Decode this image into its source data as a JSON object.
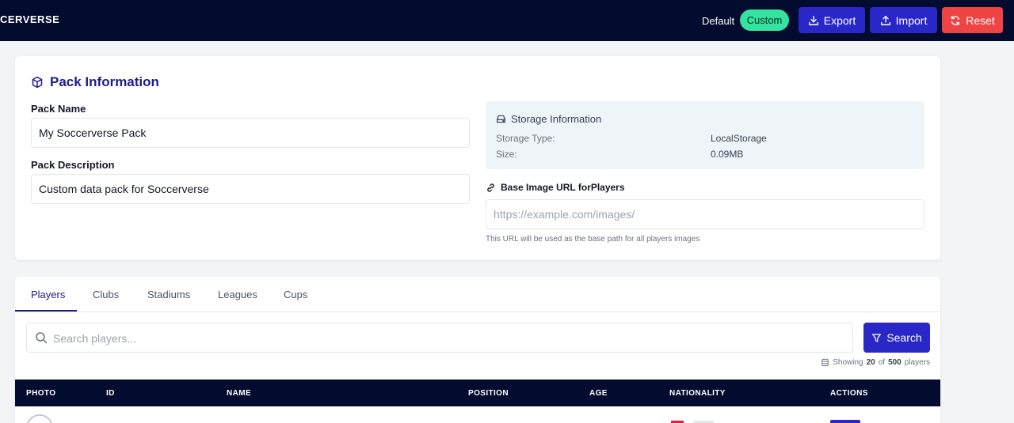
{
  "header": {
    "brand": "CERVERSE",
    "default_label": "Default",
    "custom_label": "Custom",
    "export_label": "Export",
    "import_label": "Import",
    "reset_label": "Reset"
  },
  "pack": {
    "title": "Pack Information",
    "name_label": "Pack Name",
    "name_value": "My Soccerverse Pack",
    "desc_label": "Pack Description",
    "desc_value": "Custom data pack for Soccerverse"
  },
  "storage": {
    "title": "Storage Information",
    "type_key": "Storage Type:",
    "type_value": "LocalStorage",
    "size_key": "Size:",
    "size_value": "0.09MB"
  },
  "base_url": {
    "label": "Base Image URL forPlayers",
    "placeholder": "https://example.com/images/",
    "help": "This URL will be used as the base path for all players images"
  },
  "tabs": [
    "Players",
    "Clubs",
    "Stadiums",
    "Leagues",
    "Cups"
  ],
  "search": {
    "placeholder": "Search players...",
    "button_label": "Search"
  },
  "showing": {
    "prefix": "Showing",
    "count": "20",
    "of": "of",
    "total": "500",
    "suffix": "players"
  },
  "table": {
    "headers": [
      "PHOTO",
      "ID",
      "NAME",
      "POSITION",
      "AGE",
      "NATIONALITY",
      "ACTIONS"
    ]
  },
  "colors": {
    "navbar": "#030b2e",
    "primary": "#2a27c9",
    "custom_pill": "#34e3a0",
    "danger": "#ef4444"
  }
}
